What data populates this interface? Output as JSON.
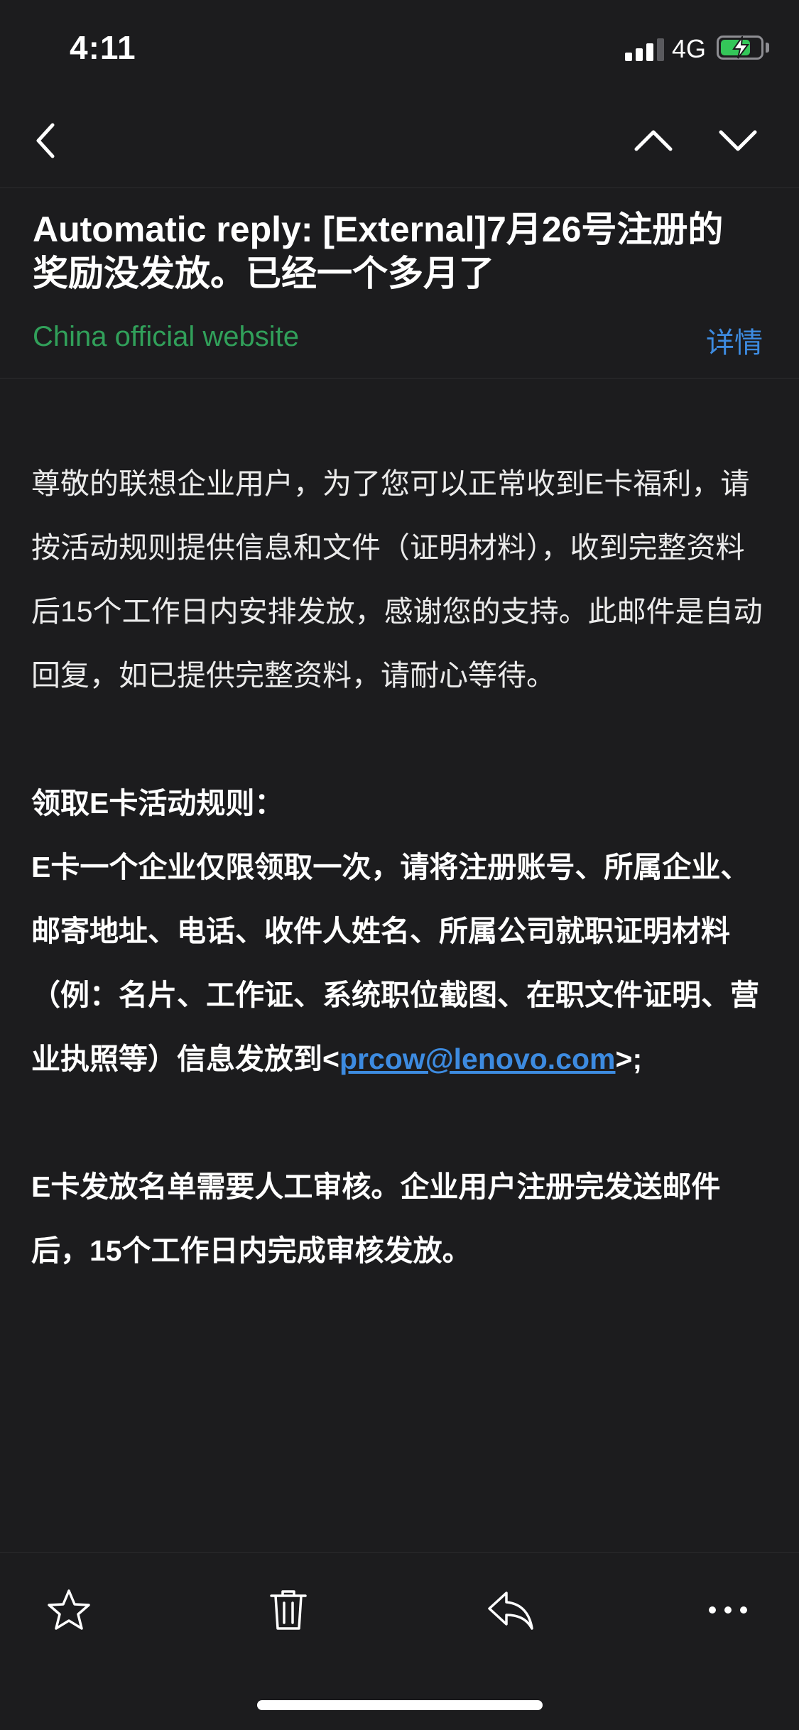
{
  "status_bar": {
    "time": "4:11",
    "network": "4G",
    "battery_level": 0.75,
    "battery_color": "#34c759"
  },
  "nav": {
    "back_icon": "chevron-left-icon",
    "prev_icon": "chevron-up-icon",
    "next_icon": "chevron-down-icon"
  },
  "email": {
    "subject": "Automatic reply: [External]7月26号注册的奖励没发放。已经一个多月了",
    "sender": "China official website",
    "details_label": "详情",
    "body": {
      "intro": "尊敬的联想企业用户，为了您可以正常收到E卡福利，请按活动规则提供信息和文件（证明材料），收到完整资料后15个工作日内安排发放，感谢您的支持。此邮件是自动回复，如已提供完整资料，请耐心等待。",
      "rules_heading": "领取E卡活动规则：",
      "rules_text": "E卡一个企业仅限领取一次，请将注册账号、所属企业、邮寄地址、电话、收件人姓名、所属公司就职证明材料（例：名片、工作证、系统职位截图、在职文件证明、营业执照等）信息发放到",
      "rules_open": "<",
      "rules_email": "prcow@lenovo.com",
      "rules_close": ">;",
      "review_text": "E卡发放名单需要人工审核。企业用户注册完发送邮件后，15个工作日内完成审核发放。"
    }
  },
  "toolbar": {
    "items": [
      "star-icon",
      "trash-icon",
      "reply-icon",
      "more-icon"
    ]
  },
  "colors": {
    "background": "#1c1c1e",
    "sender_green": "#31a05a",
    "link_blue": "#3d8be0"
  }
}
